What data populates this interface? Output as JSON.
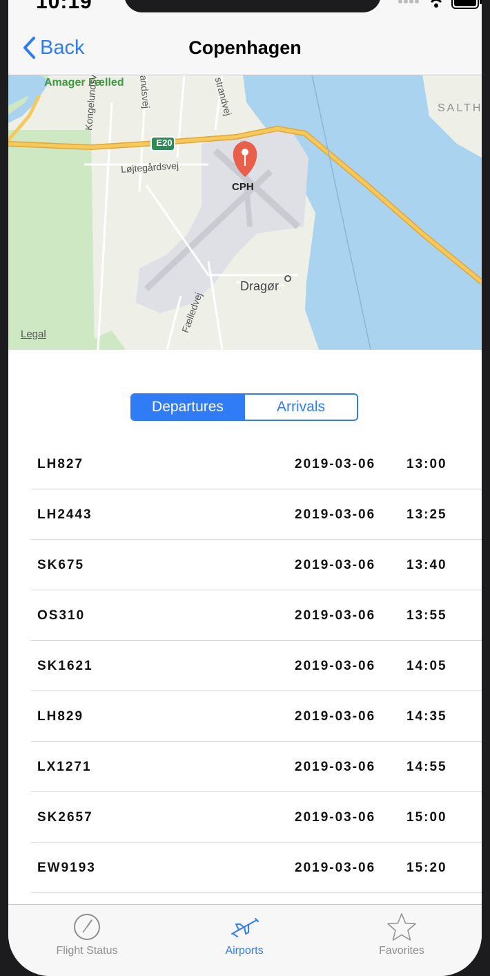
{
  "status": {
    "time": "10:19"
  },
  "nav": {
    "back_label": "Back",
    "title": "Copenhagen"
  },
  "map": {
    "labels": {
      "amager": "Amager Fælled",
      "e20": "E20",
      "kongelundsvej": "Kongelundsvej",
      "lojtegardsvej": "Løjtegårdsvej",
      "andsvej": "andsvej",
      "strandvej": "strandvej",
      "saltholm": "SALTH",
      "cph": "CPH",
      "dragor": "Dragør",
      "faelledvej": "Fælledvej"
    },
    "legal": "Legal"
  },
  "segment": {
    "departures": "Departures",
    "arrivals": "Arrivals",
    "selected": "Departures"
  },
  "flights": [
    {
      "flight": "LH827",
      "date": "2019-03-06",
      "time": "13:00"
    },
    {
      "flight": "LH2443",
      "date": "2019-03-06",
      "time": "13:25"
    },
    {
      "flight": "SK675",
      "date": "2019-03-06",
      "time": "13:40"
    },
    {
      "flight": "OS310",
      "date": "2019-03-06",
      "time": "13:55"
    },
    {
      "flight": "SK1621",
      "date": "2019-03-06",
      "time": "14:05"
    },
    {
      "flight": "LH829",
      "date": "2019-03-06",
      "time": "14:35"
    },
    {
      "flight": "LX1271",
      "date": "2019-03-06",
      "time": "14:55"
    },
    {
      "flight": "SK2657",
      "date": "2019-03-06",
      "time": "15:00"
    },
    {
      "flight": "EW9193",
      "date": "2019-03-06",
      "time": "15:20"
    }
  ],
  "tabs": [
    {
      "label": "Flight Status",
      "icon": "clock-icon",
      "active": false
    },
    {
      "label": "Airports",
      "icon": "airplane-icon",
      "active": true
    },
    {
      "label": "Favorites",
      "icon": "star-icon",
      "active": false
    }
  ],
  "colors": {
    "accent": "#2f7cf6",
    "pin": "#e8604c",
    "water": "#a9d3ee",
    "road": "#f4c95d"
  }
}
